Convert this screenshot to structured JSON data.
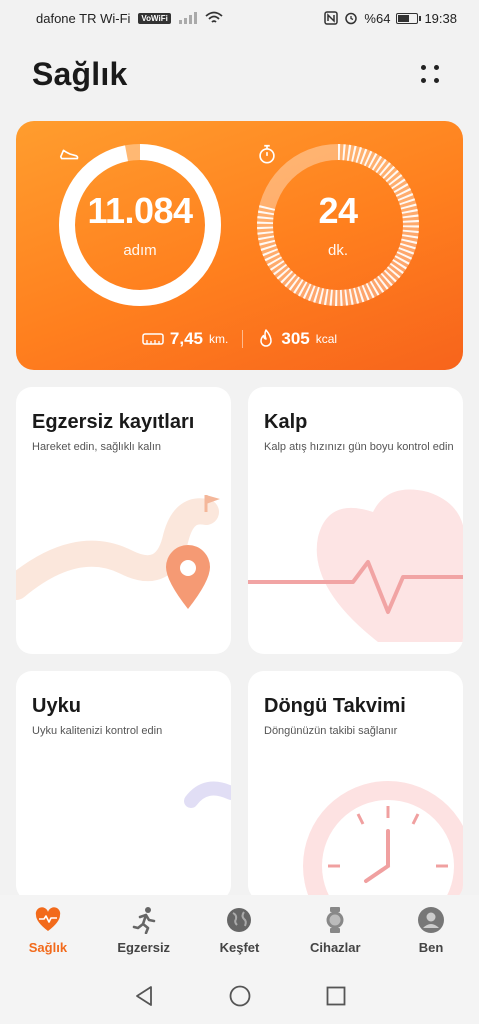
{
  "status_bar": {
    "carrier": "dafone TR Wi-Fi",
    "vowifi": "VoWiFi",
    "battery_text": "%64",
    "battery_level": 0.64,
    "time": "19:38"
  },
  "header": {
    "title": "Sağlık"
  },
  "activity": {
    "steps_value": "11.084",
    "steps_unit": "adım",
    "steps_progress": 0.97,
    "time_value": "24",
    "time_unit": "dk.",
    "time_progress": 0.8,
    "distance_value": "7,45",
    "distance_unit": "km.",
    "calories_value": "305",
    "calories_unit": "kcal"
  },
  "tiles": {
    "exercise": {
      "title": "Egzersiz kayıtları",
      "subtitle": "Hareket edin, sağlıklı kalın"
    },
    "heart": {
      "title": "Kalp",
      "subtitle": "Kalp atış hızınızı gün boyu kontrol edin"
    },
    "sleep": {
      "title": "Uyku",
      "subtitle": "Uyku kalitenizi kontrol edin"
    },
    "cycle": {
      "title": "Döngü Takvimi",
      "subtitle": "Döngünüzün takibi sağlanır"
    }
  },
  "tab_bar": {
    "active_color": "#f26a1b",
    "items": [
      {
        "label": "Sağlık",
        "icon": "heart-pulse-icon"
      },
      {
        "label": "Egzersiz",
        "icon": "running-icon"
      },
      {
        "label": "Keşfet",
        "icon": "globe-icon"
      },
      {
        "label": "Cihazlar",
        "icon": "watch-icon"
      },
      {
        "label": "Ben",
        "icon": "user-icon"
      }
    ]
  },
  "nav_bar": {
    "items": [
      "back-icon",
      "home-icon",
      "recents-icon"
    ]
  }
}
